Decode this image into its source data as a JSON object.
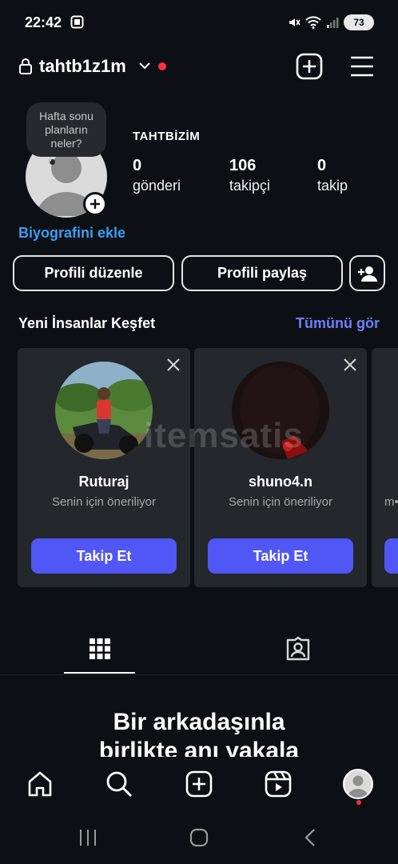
{
  "status": {
    "time": "22:42",
    "battery": "73"
  },
  "header": {
    "username": "tahtb1z1m"
  },
  "profile": {
    "note": "Hafta sonu planların neler?",
    "display_name": "TAHTBİZİM",
    "stats": [
      {
        "value": "0",
        "label": "gönderi"
      },
      {
        "value": "106",
        "label": "takipçi"
      },
      {
        "value": "0",
        "label": "takip"
      }
    ],
    "bio_link": "Biyografini ekle",
    "edit_button": "Profili düzenle",
    "share_button": "Profili paylaş"
  },
  "discover": {
    "title": "Yeni İnsanlar Keşfet",
    "see_all": "Tümünü gör",
    "cards": [
      {
        "name": "Ruturaj",
        "subtitle": "Senin için öneriliyor",
        "button": "Takip Et"
      },
      {
        "name": "shuno4.n",
        "subtitle": "Senin için öneriliyor",
        "button": "Takip Et"
      },
      {
        "subtitle": "m•"
      }
    ],
    "watermark": "itemsatis"
  },
  "empty_state": {
    "title_line1": "Bir arkadaşınla",
    "title_line2": "birlikte anı yakala"
  },
  "colors": {
    "background": "#0c1014",
    "accent": "#5057f5",
    "link": "#3d9df4",
    "see_all": "#6e7ffb",
    "notification": "#ff3040"
  },
  "icons": [
    "lock-icon",
    "chevron-down-icon",
    "create-icon",
    "menu-icon",
    "close-icon",
    "grid-icon",
    "tagged-icon",
    "home-icon",
    "search-icon",
    "add-post-icon",
    "reels-icon"
  ]
}
